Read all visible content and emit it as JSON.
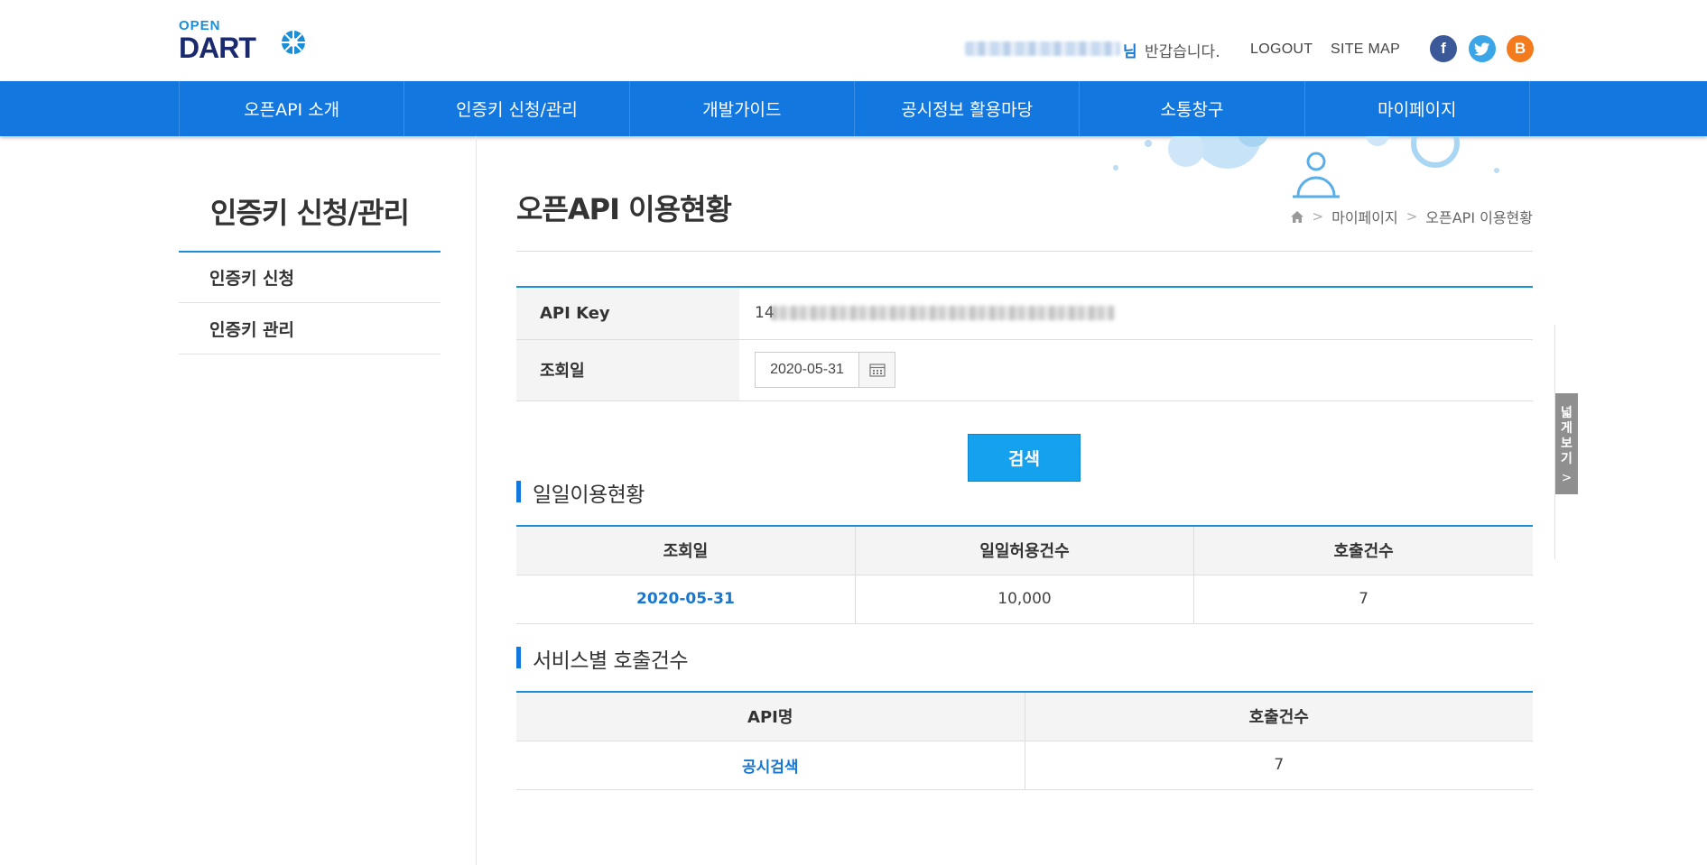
{
  "logo": {
    "open": "OPEN",
    "dart": "DART"
  },
  "header": {
    "user_suffix": "님",
    "greeting": "반갑습니다.",
    "logout": "LOGOUT",
    "sitemap": "SITE MAP",
    "sns": [
      {
        "name": "facebook-icon",
        "glyph": "f",
        "color": "#3b5998"
      },
      {
        "name": "twitter-icon",
        "glyph": "t",
        "color": "#3aa6e8"
      },
      {
        "name": "blogger-icon",
        "glyph": "B",
        "color": "#f37b1d"
      }
    ]
  },
  "nav": {
    "items": [
      "오픈API 소개",
      "인증키 신청/관리",
      "개발가이드",
      "공시정보 활용마당",
      "소통창구",
      "마이페이지"
    ]
  },
  "sidebar": {
    "title": "인증키 신청/관리",
    "items": [
      "인증키 신청",
      "인증키 관리",
      "오픈API 이용현황"
    ],
    "active_index": 2
  },
  "page": {
    "title": "오픈API 이용현황",
    "breadcrumb": [
      "마이페이지",
      "오픈API 이용현황"
    ]
  },
  "form": {
    "api_key_label": "API Key",
    "api_key_prefix": "14",
    "date_label": "조회일",
    "date_value": "2020-05-31",
    "search_label": "검색"
  },
  "daily": {
    "title": "일일이용현황",
    "headers": [
      "조회일",
      "일일허용건수",
      "호출건수"
    ],
    "rows": [
      [
        "2020-05-31",
        "10,000",
        "7"
      ]
    ]
  },
  "service": {
    "title": "서비스별 호출건수",
    "headers": [
      "API명",
      "호출건수"
    ],
    "rows": [
      [
        "공시검색",
        "7"
      ]
    ]
  },
  "widen": {
    "label": "넓게보기"
  },
  "colors": {
    "primary": "#1377e0",
    "accent": "#1592e6",
    "link": "#1677d2"
  }
}
